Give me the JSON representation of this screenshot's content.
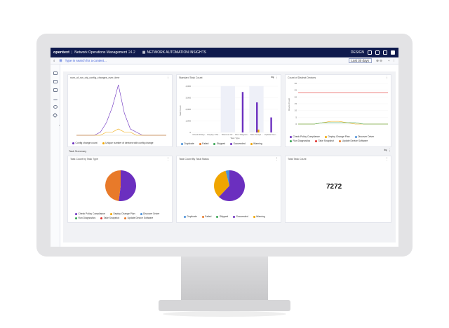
{
  "app": {
    "brand": "opentext",
    "title": "Network Operations Management",
    "version": "24.2",
    "section": "NETWORK AUTOMATION INSIGHTS",
    "design_label": "DESIGN"
  },
  "search": {
    "placeholder": "Type in search for a content...",
    "range_label": "Last 30 days"
  },
  "panels": {
    "p1_title": "num_of_nw_obj_config_changes_over_time",
    "p2_title": "Standard Task Count",
    "p3_title": "Count of Distinct Devices",
    "section_title": "Task Summary",
    "p4_title": "Task Count by Task Type",
    "p5_title": "Task Count By Task Status",
    "p6_title": "Total Task Count",
    "total_task_count": "7272"
  },
  "colors": {
    "purple": "#6b2fbf",
    "orange": "#f0a500",
    "red": "#e0322e",
    "blue": "#4a90d9",
    "darkorange": "#e87a2a",
    "green": "#3aa655"
  },
  "legends": {
    "p1": [
      "Config change count",
      "Unique number of devices with config change"
    ],
    "p2": [
      "Duplicate",
      "Failed",
      "Skipped",
      "Succeeded",
      "Warning"
    ],
    "p3": [
      "Check Policy Compliance",
      "Deploy Change Plan",
      "Discover Driver",
      "Run Diagnostics",
      "Take Snapshot",
      "Update Device Software"
    ],
    "p4": [
      "Check Policy Compliance",
      "Deploy Change Plan",
      "Discover Driver",
      "Run Diagnostics",
      "Take Snapshot",
      "Update Device Software"
    ],
    "p5": [
      "Duplicate",
      "Failed",
      "Skipped",
      "Succeeded",
      "Warning"
    ]
  },
  "chart_data": [
    {
      "type": "line",
      "title": "num_of_nw_obj_config_changes_over_time",
      "series": [
        {
          "name": "Config change count",
          "values": [
            0,
            0,
            0,
            0,
            1,
            4,
            9,
            16,
            7,
            2,
            1,
            0,
            0,
            0,
            0,
            0
          ]
        },
        {
          "name": "Unique number of devices with config change",
          "values": [
            0,
            0,
            0,
            0,
            0,
            1,
            1,
            2,
            1,
            1,
            0,
            0,
            0,
            0,
            0,
            0
          ]
        }
      ]
    },
    {
      "type": "bar",
      "title": "Standard Task Count",
      "ylabel": "Task Count",
      "xlabel": "Task Type",
      "ylim": [
        0,
        4000
      ],
      "yticks": [
        "4,000",
        "3,000",
        "2,000",
        "1,000",
        "0"
      ],
      "categories": [
        "Check Policy...",
        "Deploy Cha...",
        "Discover Dr...",
        "Run Diagnos...",
        "Take Snaps...",
        "Update Dev..."
      ],
      "series": [
        {
          "name": "Duplicate",
          "values": [
            0,
            0,
            0,
            0,
            0,
            0
          ]
        },
        {
          "name": "Failed",
          "values": [
            0,
            0,
            0,
            0,
            0,
            0
          ]
        },
        {
          "name": "Skipped",
          "values": [
            0,
            0,
            0,
            0,
            0,
            0
          ]
        },
        {
          "name": "Succeeded",
          "values": [
            0,
            0,
            0,
            3500,
            2600,
            1300
          ]
        },
        {
          "name": "Warning",
          "values": [
            0,
            0,
            0,
            0,
            250,
            0
          ]
        }
      ]
    },
    {
      "type": "line",
      "title": "Count of Distinct Devices",
      "ylabel": "Device Count",
      "yticks": [
        "30",
        "25",
        "20",
        "15",
        "10",
        "5",
        "0"
      ],
      "ylim": [
        0,
        30
      ],
      "series": [
        {
          "name": "Check Policy Compliance",
          "values": [
            23,
            23,
            23,
            23,
            23,
            23,
            23,
            23,
            23,
            23,
            23,
            23
          ]
        },
        {
          "name": "Deploy Change Plan",
          "values": [
            0,
            0,
            0,
            1,
            2,
            2,
            1,
            0,
            0,
            0,
            0,
            0
          ]
        },
        {
          "name": "Run Diagnostics",
          "values": [
            0,
            0,
            0,
            1,
            1,
            1,
            1,
            1,
            0,
            0,
            0,
            0
          ]
        }
      ]
    },
    {
      "type": "pie",
      "title": "Task Count by Task Type",
      "categories": [
        "Update Device Software",
        "Take Snapshot"
      ],
      "values": [
        52,
        48
      ]
    },
    {
      "type": "pie",
      "title": "Task Count By Task Status",
      "categories": [
        "Succeeded",
        "Warning",
        "Skipped"
      ],
      "values": [
        62,
        34,
        4
      ]
    }
  ]
}
